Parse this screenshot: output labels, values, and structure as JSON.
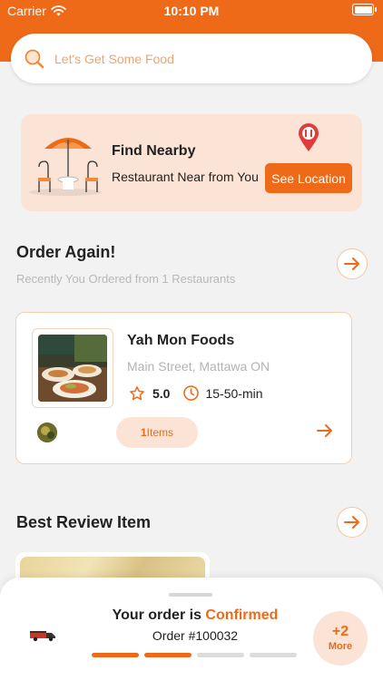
{
  "status_bar": {
    "carrier": "Carrier",
    "time": "10:10 PM"
  },
  "search": {
    "placeholder": "Let's Get Some Food",
    "icon": "search-icon"
  },
  "nearby": {
    "title": "Find Nearby",
    "subtitle": "Restaurant Near from You",
    "button": "See Location"
  },
  "order_again": {
    "title": "Order Again!",
    "subtitle": "Recently You Ordered from 1 Restaurants",
    "restaurant": {
      "name": "Yah Mon Foods",
      "address": "Main Street, Mattawa ON",
      "rating": "5.0",
      "time": "15-50-min",
      "items_count": "1",
      "items_label": "Items"
    }
  },
  "best_review": {
    "title": "Best Review Item"
  },
  "order_sheet": {
    "status_prefix": "Your order is",
    "status_value": "Confirmed",
    "order_number": "Order #100032",
    "progress": {
      "completed_steps": 2,
      "total_steps": 4
    },
    "more_count": "+2",
    "more_label": "More"
  },
  "colors": {
    "accent": "#ef6a18",
    "accent_light": "#fbe3d6",
    "background": "#f2f2f2"
  }
}
